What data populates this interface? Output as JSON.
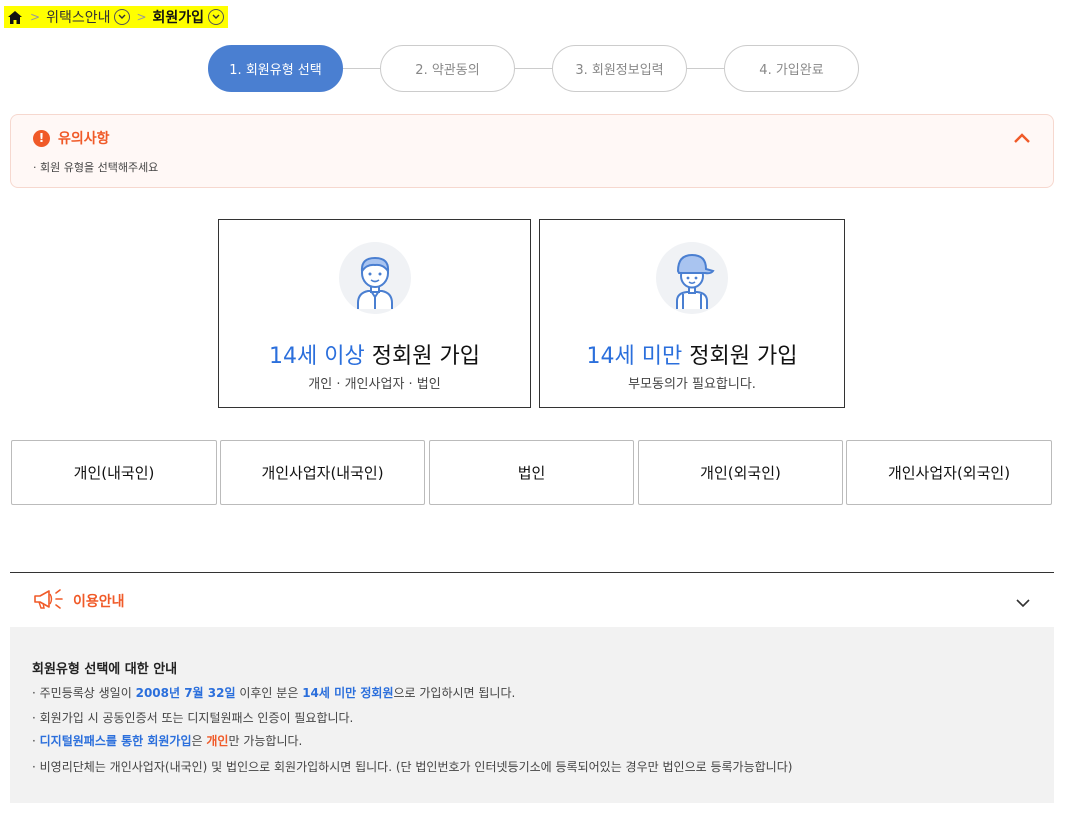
{
  "breadcrumb": {
    "level1": "위택스안내",
    "level2": "회원가입"
  },
  "steps": [
    "1. 회원유형 선택",
    "2. 약관동의",
    "3. 회원정보입력",
    "4. 가입완료"
  ],
  "notice": {
    "title": "유의사항",
    "text": "· 회원 유형을 선택해주세요"
  },
  "cards": {
    "adult": {
      "highlight": "14세 이상",
      "rest": " 정회원 가입",
      "sub": "개인 · 개인사업자 · 법인"
    },
    "minor": {
      "highlight": "14세 미만",
      "rest": " 정회원 가입",
      "sub": "부모동의가 필요합니다."
    }
  },
  "types": [
    "개인(내국인)",
    "개인사업자(내국인)",
    "법인",
    "개인(외국인)",
    "개인사업자(외국인)"
  ],
  "guide": {
    "title": "이용안내",
    "box_title": "회원유형 선택에 대한 안내",
    "item1": {
      "a": "· 주민등록상 생일이 ",
      "b": "2008년 7월 32일",
      "c": " 이후인 분은 ",
      "d": "14세 미만 정회원",
      "e": "으로 가입하시면 됩니다."
    },
    "item2": "· 회원가입 시 공동인증서 또는 디지털원패스 인증이 필요합니다.",
    "item3": {
      "a": "· ",
      "b": "디지털원패스를 통한 회원가입",
      "c": "은 ",
      "d": "개인",
      "e": "만 가능합니다."
    },
    "item4": "· 비영리단체는 개인사업자(내국인) 및 법인으로 회원가입하시면 됩니다. (단 법인번호가 인터넷등기소에 등록되어있는 경우만 법인으로 등록가능합니다)"
  },
  "colors": {
    "accent": "#4a7fd1",
    "highlight": "#2b6fdc",
    "warning": "#f05a28",
    "breadcrumb_bg": "#ffff00"
  }
}
